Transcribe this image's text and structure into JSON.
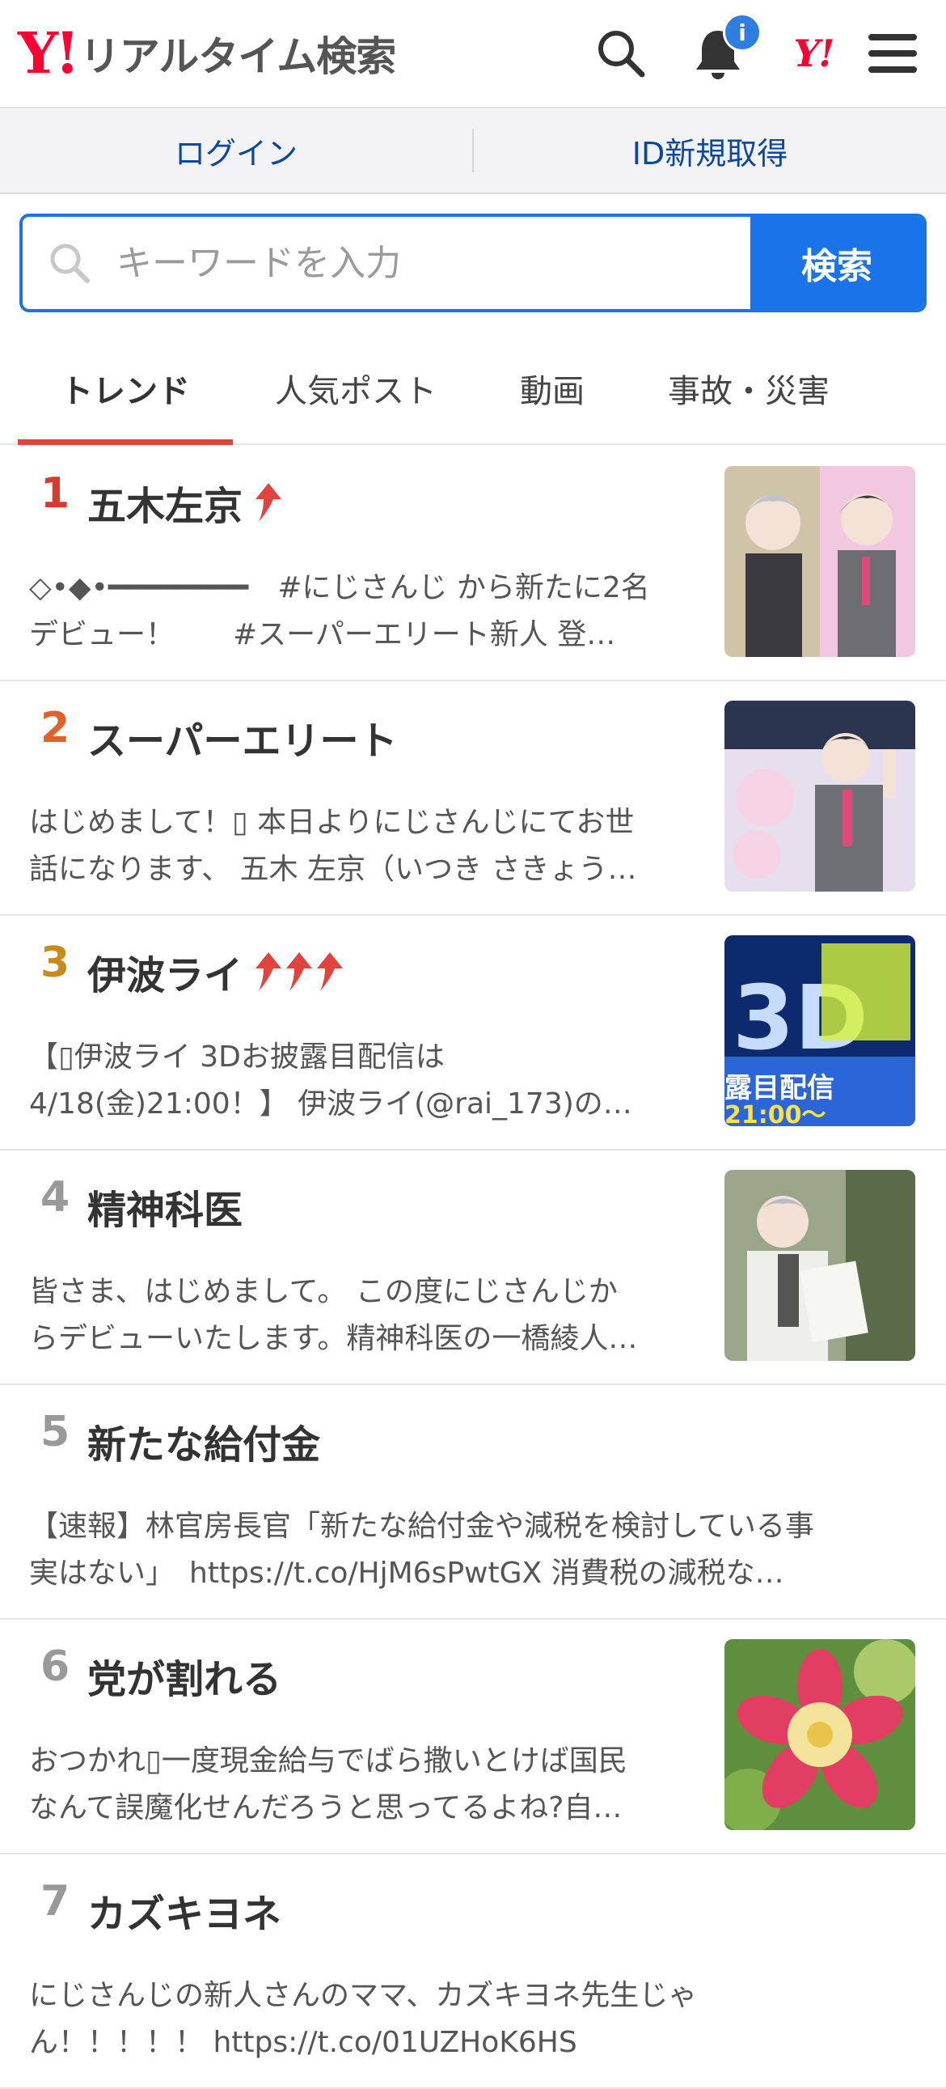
{
  "header": {
    "logo_y": "Y!",
    "logo_text": "リアルタイム検索",
    "notification_badge": "i",
    "yahoo_mark": "Y!"
  },
  "login_bar": {
    "login": "ログイン",
    "register": "ID新規取得"
  },
  "search": {
    "placeholder": "キーワードを入力",
    "button": "検索"
  },
  "tabs": [
    {
      "label": "トレンド",
      "active": true
    },
    {
      "label": "人気ポスト",
      "active": false
    },
    {
      "label": "動画",
      "active": false
    },
    {
      "label": "事故・災害",
      "active": false
    }
  ],
  "trends": [
    {
      "rank": "1",
      "rank_color": "#d83a2f",
      "title": "五木左京",
      "arrows": 1,
      "line1": "◇•◆•━━━━━━━━　#にじさんじ から新たに2名",
      "line2": "デビュー！　　#スーパーエリート新人 登…",
      "thumbnail": "anime-characters-image"
    },
    {
      "rank": "2",
      "rank_color": "#e0622b",
      "title": "スーパーエリート",
      "arrows": 0,
      "line1": "はじめまして！▯ 本日よりにじさんじにてお世",
      "line2": "話になります、 五木 左京（いつき さきょう…",
      "thumbnail": "anime-character-presentation-image"
    },
    {
      "rank": "3",
      "rank_color": "#c88a1e",
      "title": "伊波ライ",
      "arrows": 3,
      "line1": "【▯伊波ライ 3Dお披露目配信は",
      "line2": "4/18(金)21:00！】 伊波ライ(@rai_173)の…",
      "thumbnail": "3d-stream-poster-image"
    },
    {
      "rank": "4",
      "rank_color": "#999999",
      "title": "精神科医",
      "arrows": 0,
      "line1": "皆さま、はじめまして。 この度にじさんじか",
      "line2": "らデビューいたします。精神科医の一橋綾人…",
      "thumbnail": "anime-doctor-image"
    },
    {
      "rank": "5",
      "rank_color": "#999999",
      "title": "新たな給付金",
      "arrows": 0,
      "line1": "【速報】林官房長官「新たな給付金や減税を検討している事",
      "line2": "実はない」　https://t.co/HjM6sPwtGX 消費税の減税な…",
      "thumbnail": ""
    },
    {
      "rank": "6",
      "rank_color": "#999999",
      "title": "党が割れる",
      "arrows": 0,
      "line1": "おつかれ▯一度現金給与でばら撒いとけば国民",
      "line2": "なんて誤魔化せんだろうと思ってるよね?自…",
      "thumbnail": "flower-image"
    },
    {
      "rank": "7",
      "rank_color": "#999999",
      "title": "カズキヨネ",
      "arrows": 0,
      "line1": "にじさんじの新人さんのママ、カズキヨネ先生じゃ",
      "line2": "ん！！！！！ https://t.co/01UZHoK6HS",
      "thumbnail": ""
    }
  ]
}
